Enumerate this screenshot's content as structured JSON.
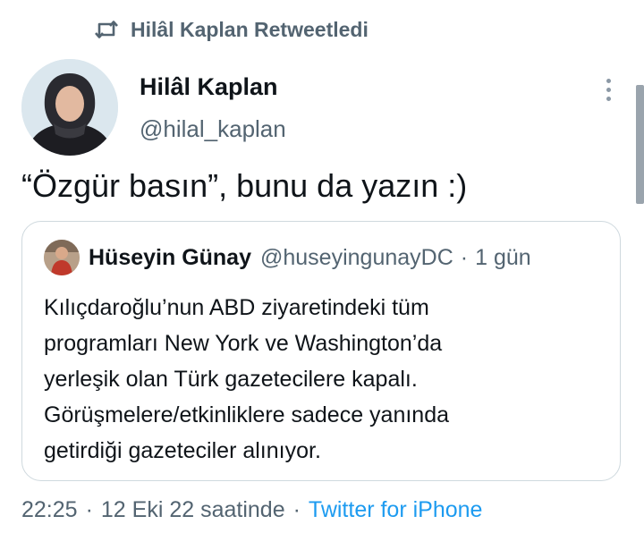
{
  "retweet_banner": {
    "icon": "retweet-icon",
    "text": "Hilâl Kaplan Retweetledi"
  },
  "tweet": {
    "author": {
      "name": "Hilâl Kaplan",
      "handle": "@hilal_kaplan",
      "avatar": "avatar-photo"
    },
    "text": "“Özgür basın”, bunu da yazın :)",
    "more_icon": "more-vertical-icon"
  },
  "quoted_tweet": {
    "author": {
      "name": "Hüseyin Günay",
      "handle": "@huseyingunayDC",
      "avatar": "avatar-photo"
    },
    "separator": "·",
    "time": "1 gün",
    "lines": [
      "Kılıçdaroğlu’nun ABD ziyaretindeki tüm",
      "programları New York ve Washington’da",
      "yerleşik olan Türk gazetecilere kapalı.",
      "Görüşmelere/etkinliklere sadece yanında",
      "getirdiği gazeteciler alınıyor."
    ]
  },
  "footer": {
    "time": "22:25",
    "separator": "·",
    "date": "12 Eki 22 saatinde",
    "source": "Twitter for iPhone"
  },
  "colors": {
    "text_primary": "#0f1419",
    "text_secondary": "#536471",
    "link": "#1d9bf0",
    "border": "#cfd9de"
  }
}
